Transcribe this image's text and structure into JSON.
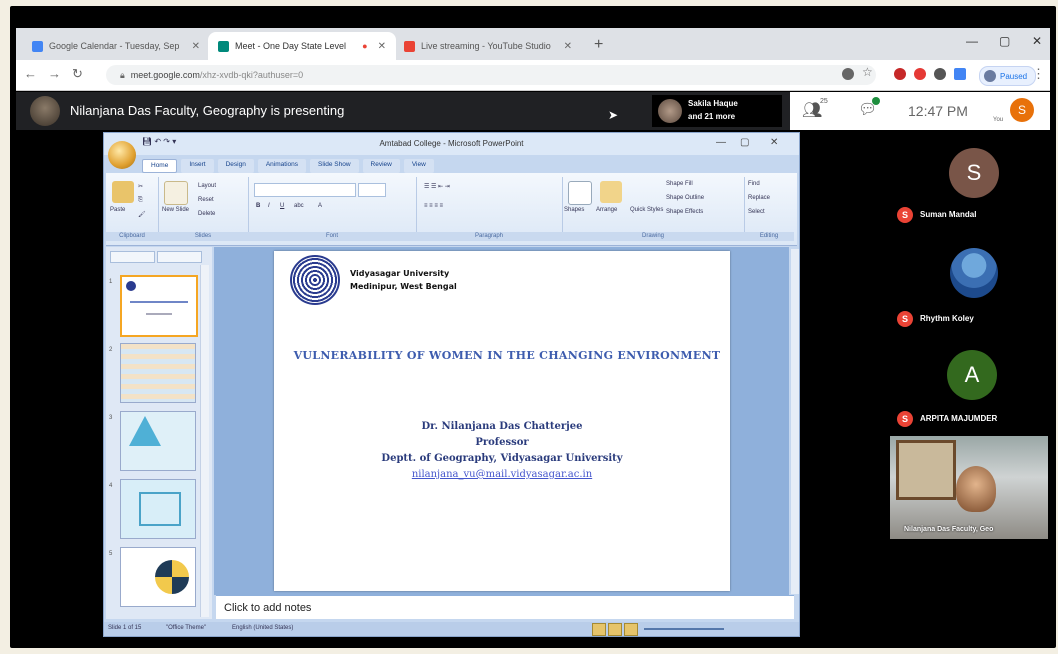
{
  "browser": {
    "tabs": [
      {
        "label": "Google Calendar - Tuesday, Sep",
        "color": "#4285f4"
      },
      {
        "label": "Meet - One Day State Level",
        "color": "#00897b"
      },
      {
        "label": "Live streaming - YouTube Studio",
        "color": "#ea4335"
      }
    ],
    "address": "meet.google.com",
    "address_path": "/xhz-xvdb-qki?authuser=0",
    "profile": "Paused"
  },
  "meet": {
    "presenting_text": "Nilanjana Das Faculty, Geography is presenting",
    "join_name": "Sakila Haque",
    "join_more": "and 21 more",
    "people_count": "25",
    "time": "12:47 PM",
    "you_initial": "S",
    "you_label": "You"
  },
  "ppt": {
    "window_title": "Amtabad College - Microsoft PowerPoint",
    "ribbon_tabs": [
      "Home",
      "Insert",
      "Design",
      "Animations",
      "Slide Show",
      "Review",
      "View"
    ],
    "groups": [
      "Clipboard",
      "Slides",
      "Font",
      "Paragraph",
      "Drawing",
      "Editing"
    ],
    "clipboard": {
      "paste": "Paste",
      "cut": "Cut",
      "copy": "Copy",
      "fmt": "Format Painter"
    },
    "slides_btns": {
      "new": "New Slide",
      "layout": "Layout",
      "reset": "Reset",
      "delete": "Delete"
    },
    "drawing": {
      "shapes": "Shapes",
      "arrange": "Arrange",
      "quick": "Quick Styles",
      "fill": "Shape Fill",
      "outline": "Shape Outline",
      "effects": "Shape Effects"
    },
    "editing": {
      "find": "Find",
      "replace": "Replace",
      "select": "Select"
    },
    "notes_placeholder": "Click to add notes",
    "status": {
      "slide": "Slide 1 of 15",
      "theme": "\"Office Theme\"",
      "lang": "English (United States)"
    }
  },
  "slide": {
    "university": "Vidyasagar University",
    "location": "Medinipur, West Bengal",
    "title": "VULNERABILITY OF WOMEN IN THE CHANGING ENVIRONMENT",
    "author": "Dr. Nilanjana Das Chatterjee",
    "designation": "Professor",
    "department": "Deptt. of Geography, Vidyasagar University",
    "email": "nilanjana_vu@mail.vidyasagar.ac.in"
  },
  "participants": [
    {
      "initial": "S",
      "name": "Suman Mandal",
      "color": "#795548"
    },
    {
      "initial": "",
      "name": "Rhythm Koley",
      "color": "#3b6fb3"
    },
    {
      "initial": "A",
      "name": "ARPITA MAJUMDER",
      "color": "#33691e"
    }
  ],
  "video_label": "Nilanjana Das Faculty, Geo"
}
